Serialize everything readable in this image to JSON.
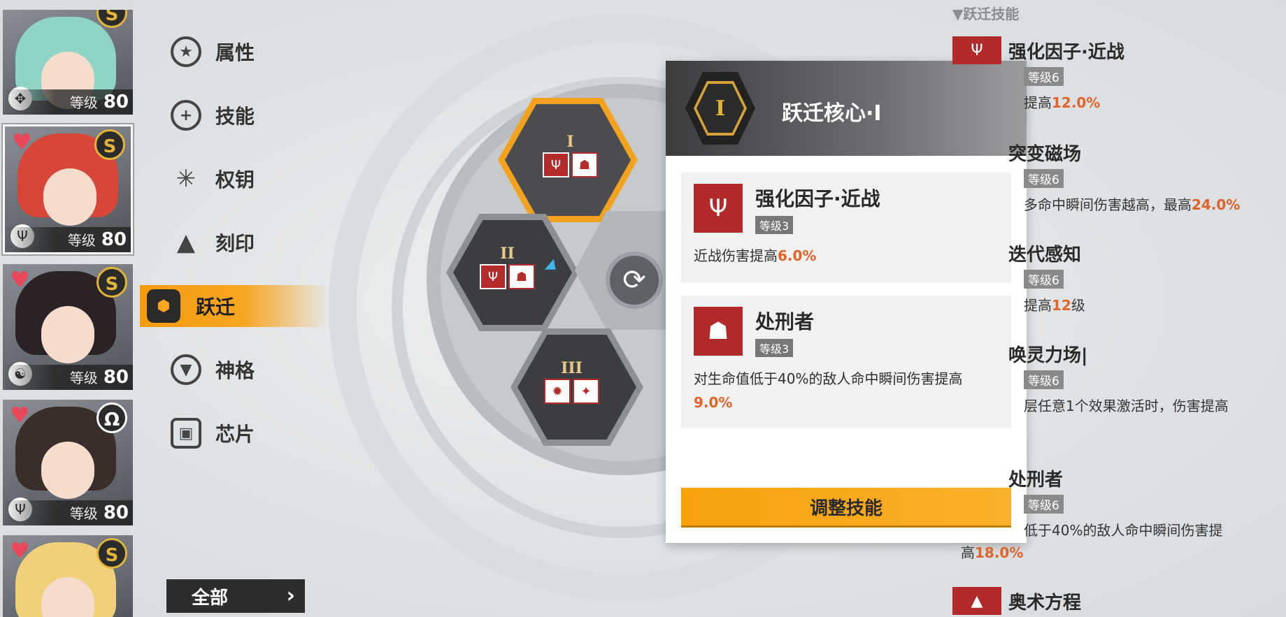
{
  "characters": [
    {
      "level_label": "等级",
      "level": "80",
      "favorite": false,
      "rank": "S",
      "hair_color": "#8fd4c4",
      "class_icon": "compass-icon"
    },
    {
      "level_label": "等级",
      "level": "80",
      "favorite": true,
      "rank": "S",
      "hair_color": "#d8463a",
      "class_icon": "trident-icon",
      "selected": true
    },
    {
      "level_label": "等级",
      "level": "80",
      "favorite": true,
      "rank": "S",
      "hair_color": "#2a2226",
      "class_icon": "swirl-icon"
    },
    {
      "level_label": "等级",
      "level": "80",
      "favorite": true,
      "rank": "Ω",
      "hair_color": "#3a2e2a",
      "class_icon": "trident-icon"
    },
    {
      "favorite": true,
      "rank": "S",
      "hair_color": "#f0d07a"
    }
  ],
  "nav": {
    "items": [
      {
        "label": "属性",
        "icon": "star-circle-icon"
      },
      {
        "label": "技能",
        "icon": "plus-circle-icon"
      },
      {
        "label": "权钥",
        "icon": "key-burst-icon"
      },
      {
        "label": "刻印",
        "icon": "triangle-mark-icon"
      },
      {
        "label": "跃迁",
        "icon": "hex-core-icon",
        "active": true
      },
      {
        "label": "神格",
        "icon": "down-triangle-circle-icon"
      },
      {
        "label": "芯片",
        "icon": "chip-icon"
      }
    ],
    "all_button": "全部"
  },
  "hex_grid": {
    "slots": [
      {
        "numeral": "I",
        "icons": [
          "trident",
          "hood"
        ]
      },
      {
        "numeral": "II",
        "icons": [
          "trident",
          "hood"
        ]
      },
      {
        "numeral": "III",
        "icons": [
          "spider",
          "cannon"
        ]
      }
    ]
  },
  "popup": {
    "badge": "I",
    "title": "跃迁核心·I",
    "skills": [
      {
        "name": "强化因子·近战",
        "level": "等级3",
        "desc_prefix": "近战伤害提高",
        "desc_value": "6.0%",
        "desc_suffix": ""
      },
      {
        "name": "处刑者",
        "level": "等级3",
        "desc_prefix": "对生命值低于40%的敌人命中瞬间伤害提高",
        "desc_value": "9.0%",
        "desc_suffix": ""
      }
    ],
    "adjust_button": "调整技能"
  },
  "right_panel": {
    "section_title": "▼跃迁技能",
    "items": [
      {
        "name": "强化因子·近战",
        "level": "等级6",
        "desc_prefix": "提高",
        "desc_value": "12.0%",
        "desc_suffix": ""
      },
      {
        "name": "突变磁场",
        "level": "等级6",
        "desc_prefix": "多命中瞬间伤害越高，最高",
        "desc_value": "24.0%",
        "desc_suffix": ""
      },
      {
        "name": "迭代感知",
        "level": "等级6",
        "desc_prefix": "提高",
        "desc_value": "12",
        "desc_suffix": "级"
      },
      {
        "name": "唤灵力场|",
        "level": "等级6",
        "desc_prefix": "层任意1个效果激活时，伤害提高",
        "desc_value": "",
        "desc_suffix": ""
      },
      {
        "name": "处刑者",
        "level": "等级6",
        "desc_prefix": "低于40%的敌人命中瞬间伤害提",
        "desc_value": "",
        "desc_suffix": "",
        "desc2_prefix": "高",
        "desc2_value": "18.0%"
      },
      {
        "name": "奥术方程"
      }
    ]
  },
  "colors": {
    "accent": "#f7a521",
    "highlight": "#e0632a",
    "skill_red": "#b02a2a"
  }
}
